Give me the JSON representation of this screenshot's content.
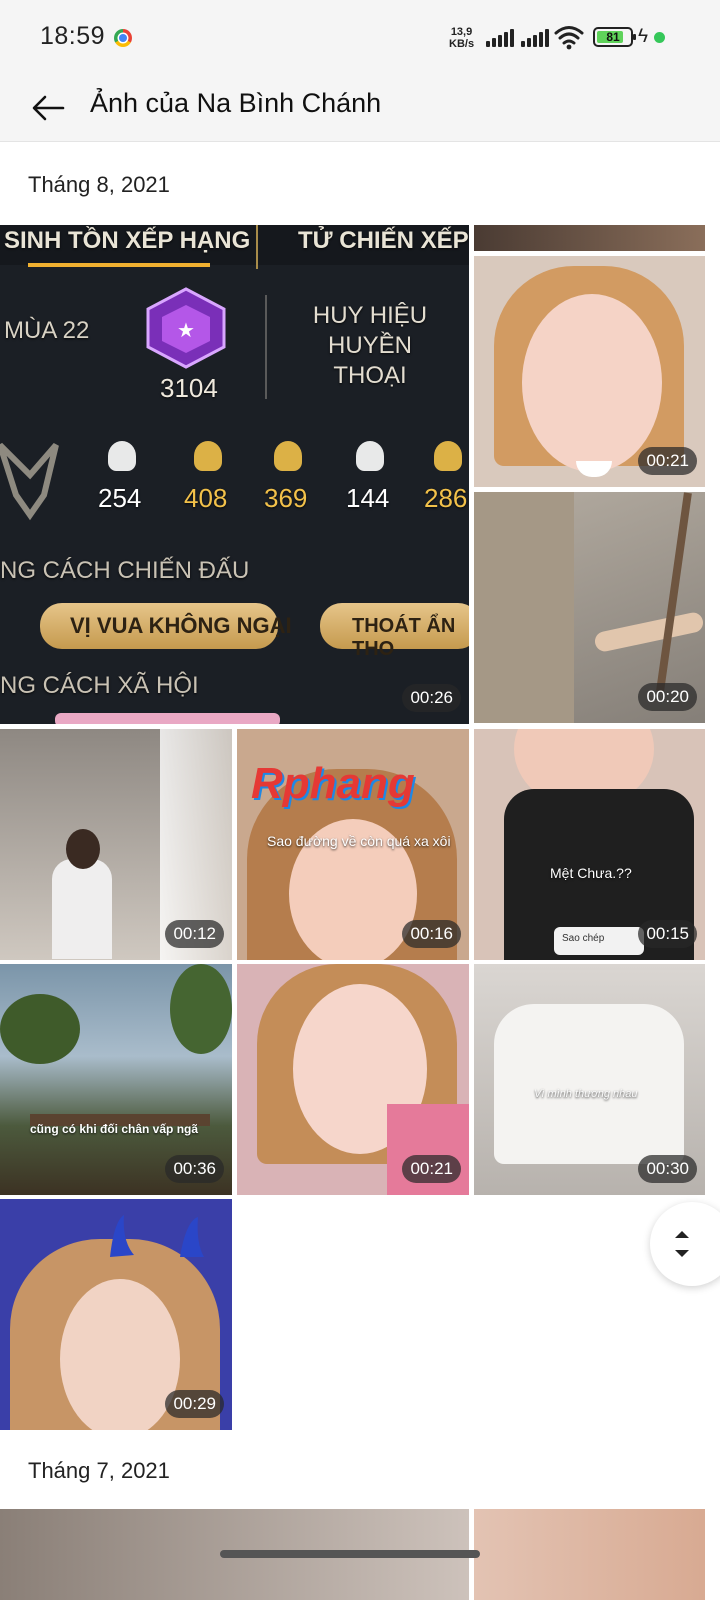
{
  "status_bar": {
    "time": "18:59",
    "net_speed_value": "13,9",
    "net_speed_unit": "KB/s",
    "battery": "81",
    "battery_level": 0.81
  },
  "header": {
    "title": "Ảnh của Na Bình Chánh"
  },
  "sections": [
    {
      "label": "Tháng 8, 2021",
      "items": [
        {
          "duration": "00:26"
        },
        {
          "duration": "00:21"
        },
        {
          "duration": "00:20"
        },
        {
          "duration": "00:12"
        },
        {
          "duration": "00:16"
        },
        {
          "duration": "00:15"
        },
        {
          "duration": "00:36"
        },
        {
          "duration": "00:21"
        },
        {
          "duration": "00:30"
        },
        {
          "duration": "00:29"
        }
      ]
    },
    {
      "label": "Tháng 7, 2021"
    }
  ],
  "thumb_text": {
    "game_rank_title": "SINH TỒN XẾP HẠNG",
    "game_tab2": "TỬ CHIẾN XẾP",
    "game_season": "MÙA 22",
    "game_points": "3104",
    "game_badge": "HUY HIỆU HUYỀN THOẠI",
    "game_stats": [
      "254",
      "408",
      "369",
      "144",
      "286"
    ],
    "game_style_label": "NG CÁCH CHIẾN ĐẤU",
    "game_style1": "VỊ VUA KHÔNG NGẠI",
    "game_style2": "THOÁT ẨN THO",
    "game_social_label": "NG CÁCH XÃ HỘI",
    "watermark": "Rphang",
    "caption_1": "Sao đường về còn quá xa xôi",
    "caption_2": "Mệt Chưa.??",
    "caption_2_menu": "Sao chép",
    "caption_3": "cũng có khi đối chân vấp ngã",
    "caption_4": "Vì mình thương nhau"
  },
  "colors": {
    "accent": "#111111",
    "background": "#ffffff",
    "header_bg": "#f5f5f5",
    "duration_badge": "#3a3a3a"
  }
}
